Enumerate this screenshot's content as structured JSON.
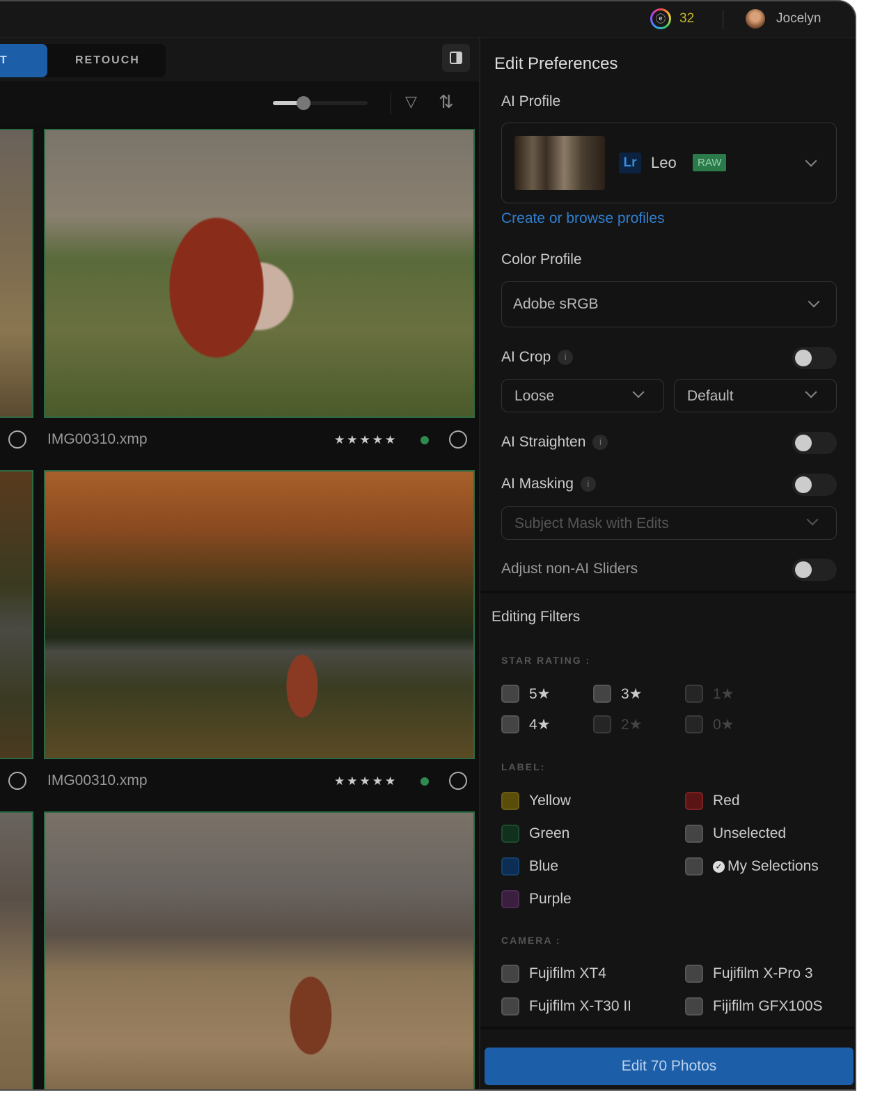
{
  "topbar": {
    "credits": "32",
    "logo": "ⓔ",
    "user_name": "Jocelyn"
  },
  "tabs": {
    "active": "T",
    "retouch": "RETOUCH"
  },
  "toolbar": {
    "zoom_fraction": 0.32,
    "filter_icon": "▽",
    "sort_icon": "⇅"
  },
  "photos": [
    {
      "name": "IMG00310.xmp",
      "stars": "★★★★★"
    },
    {
      "name": "IMG00310.xmp",
      "stars": "★★★★★"
    }
  ],
  "prefs": {
    "title": "Edit Preferences",
    "ai_profile_label": "AI Profile",
    "profile": {
      "app": "Lr",
      "name": "Leo",
      "badge": "RAW"
    },
    "browse_link": "Create or browse profiles",
    "color_profile_label": "Color Profile",
    "color_profile_value": "Adobe sRGB",
    "ai_crop_label": "AI Crop",
    "crop_mode": "Loose",
    "crop_ratio": "Default",
    "ai_straighten_label": "AI Straighten",
    "ai_masking_label": "AI Masking",
    "mask_placeholder": "Subject Mask with Edits",
    "non_ai_label": "Adjust non-AI Sliders",
    "info": "i"
  },
  "filters": {
    "title": "Editing Filters",
    "star_heading": "STAR RATING :",
    "stars": [
      "5★",
      "3★",
      "1★",
      "4★",
      "2★",
      "0★"
    ],
    "label_heading": "LABEL:",
    "labels": [
      "Yellow",
      "Red",
      "Green",
      "Unselected",
      "Blue",
      "My Selections",
      "Purple"
    ],
    "camera_heading": "CAMERA :",
    "cameras": [
      "Fujifilm XT4",
      "Fujifilm X-Pro 3",
      "Fujifilm X-T30 II",
      "Fijifilm GFX100S"
    ]
  },
  "edit_button": "Edit 70 Photos",
  "colors": {
    "accent": "#1d5ea8",
    "yellow": "#5a4d0a",
    "red": "#5a1414",
    "green": "#12301e",
    "blue": "#0c2e55",
    "purple": "#3a1f3f",
    "raw": "#2a7a4a"
  }
}
